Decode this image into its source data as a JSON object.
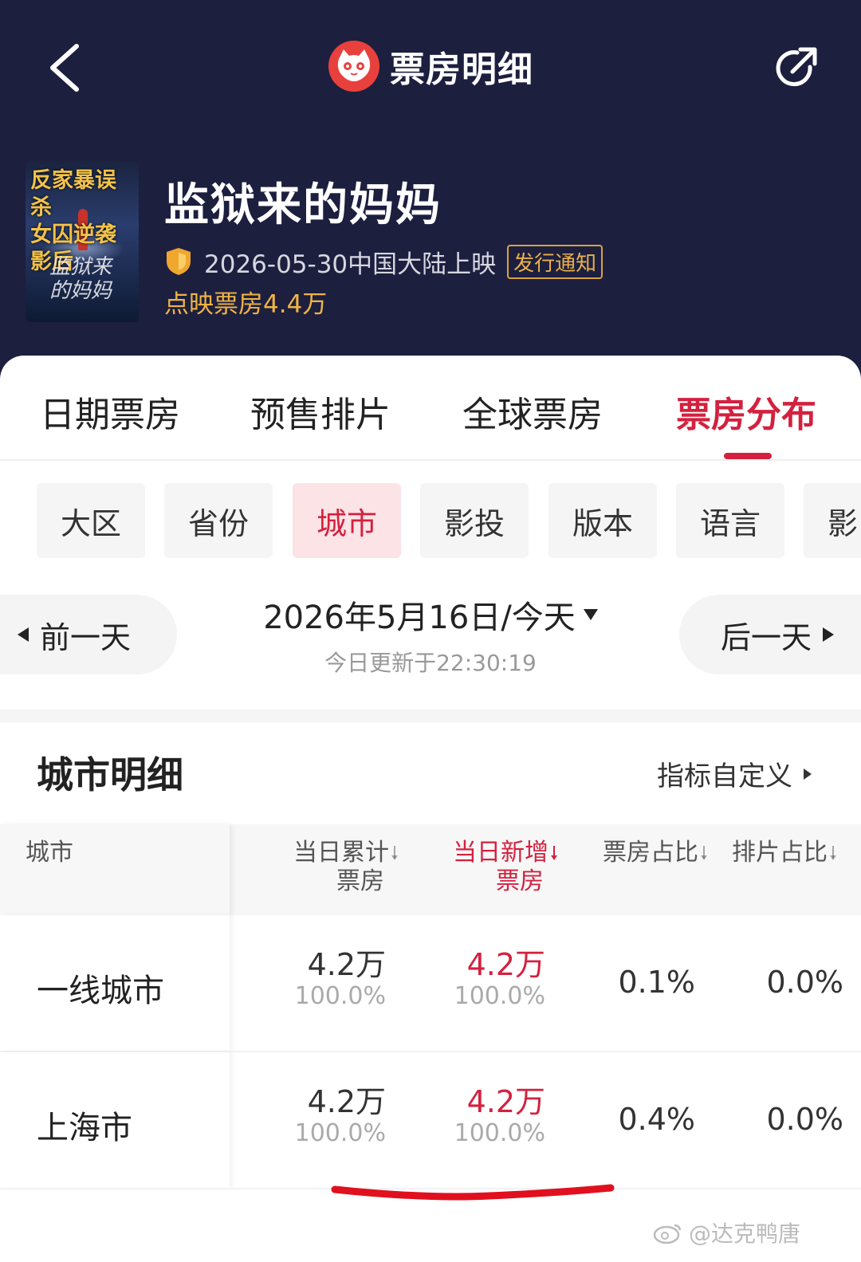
{
  "header": {
    "title": "票房明细",
    "colors": {
      "background": "#1d1f3f",
      "accent": "#d3213f",
      "gold": "#f0b445"
    }
  },
  "movie": {
    "title": "监狱来的妈妈",
    "poster_tagline_line1": "反家暴误杀",
    "poster_tagline_line2": "女囚逆袭影后",
    "poster_title": "监狱来的妈妈",
    "release_info": "2026-05-30中国大陆上映",
    "release_badge": "发行通知",
    "preview_box_office": "点映票房4.4万"
  },
  "tabs": [
    {
      "label": "日期票房",
      "active": false
    },
    {
      "label": "预售排片",
      "active": false
    },
    {
      "label": "全球票房",
      "active": false
    },
    {
      "label": "票房分布",
      "active": true
    }
  ],
  "chips": [
    {
      "label": "大区",
      "active": false
    },
    {
      "label": "省份",
      "active": false
    },
    {
      "label": "城市",
      "active": true
    },
    {
      "label": "影投",
      "active": false
    },
    {
      "label": "版本",
      "active": false
    },
    {
      "label": "语言",
      "active": false
    },
    {
      "label": "影",
      "active": false
    }
  ],
  "date_nav": {
    "prev_label": "前一天",
    "next_label": "后一天",
    "date": "2026年5月16日/今天",
    "update_text": "今日更新于22:30:19"
  },
  "section": {
    "title": "城市明细",
    "metric_link": "指标自定义"
  },
  "table": {
    "columns": [
      {
        "label": "城市"
      },
      {
        "line1": "当日累计",
        "line2": "票房"
      },
      {
        "line1": "当日新增",
        "line2": "票房"
      },
      {
        "label": "票房占比"
      },
      {
        "label": "排片占比"
      }
    ],
    "rows": [
      {
        "city": "一线城市",
        "cum": "4.2万",
        "cum_pct": "100.0%",
        "new": "4.2万",
        "new_pct": "100.0%",
        "bo_share": "0.1%",
        "show_share": "0.0%"
      },
      {
        "city": "上海市",
        "cum": "4.2万",
        "cum_pct": "100.0%",
        "new": "4.2万",
        "new_pct": "100.0%",
        "bo_share": "0.4%",
        "show_share": "0.0%"
      }
    ]
  },
  "watermark": "@达克鸭唐"
}
